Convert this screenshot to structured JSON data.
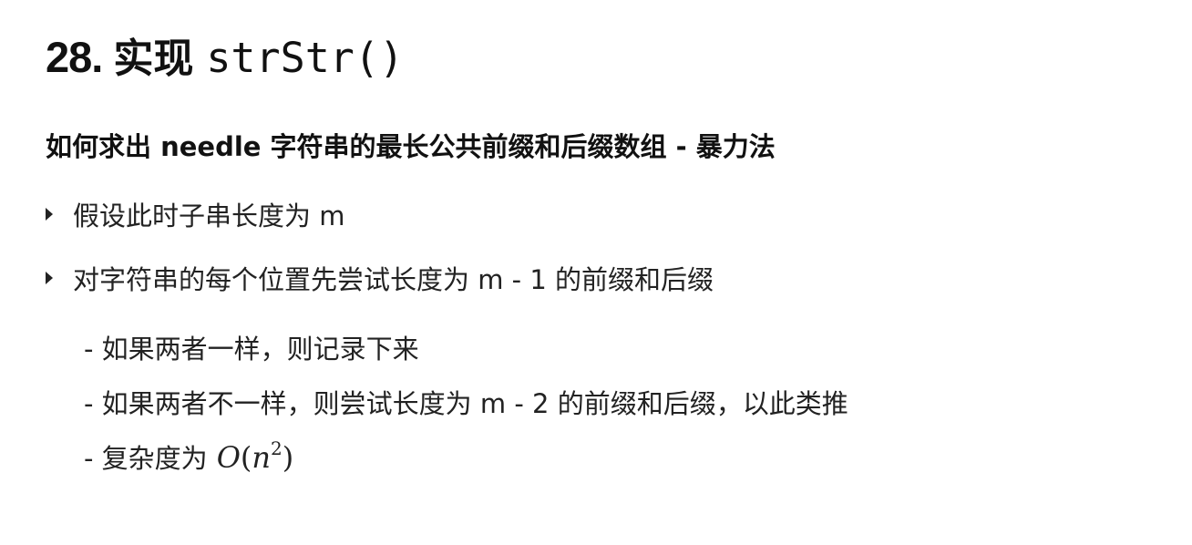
{
  "slide": {
    "title": {
      "number": "28.",
      "text": "实现",
      "code": "strStr()"
    },
    "subtitle": "如何求出 needle 字符串的最长公共前缀和后缀数组 - 暴力法",
    "bullets": [
      {
        "text": "假设此时子串长度为 m"
      },
      {
        "text": "对字符串的每个位置先尝试长度为 m - 1 的前缀和后缀"
      }
    ],
    "sub_items": [
      {
        "text": "- 如果两者一样，则记录下来"
      },
      {
        "text": "- 如果两者不一样，则尝试长度为 m - 2 的前缀和后缀，以此类推"
      },
      {
        "text": "- 复杂度为",
        "math": {
          "O": "O",
          "open": "(",
          "n": "n",
          "exp": "2",
          "close": ")"
        }
      }
    ]
  }
}
